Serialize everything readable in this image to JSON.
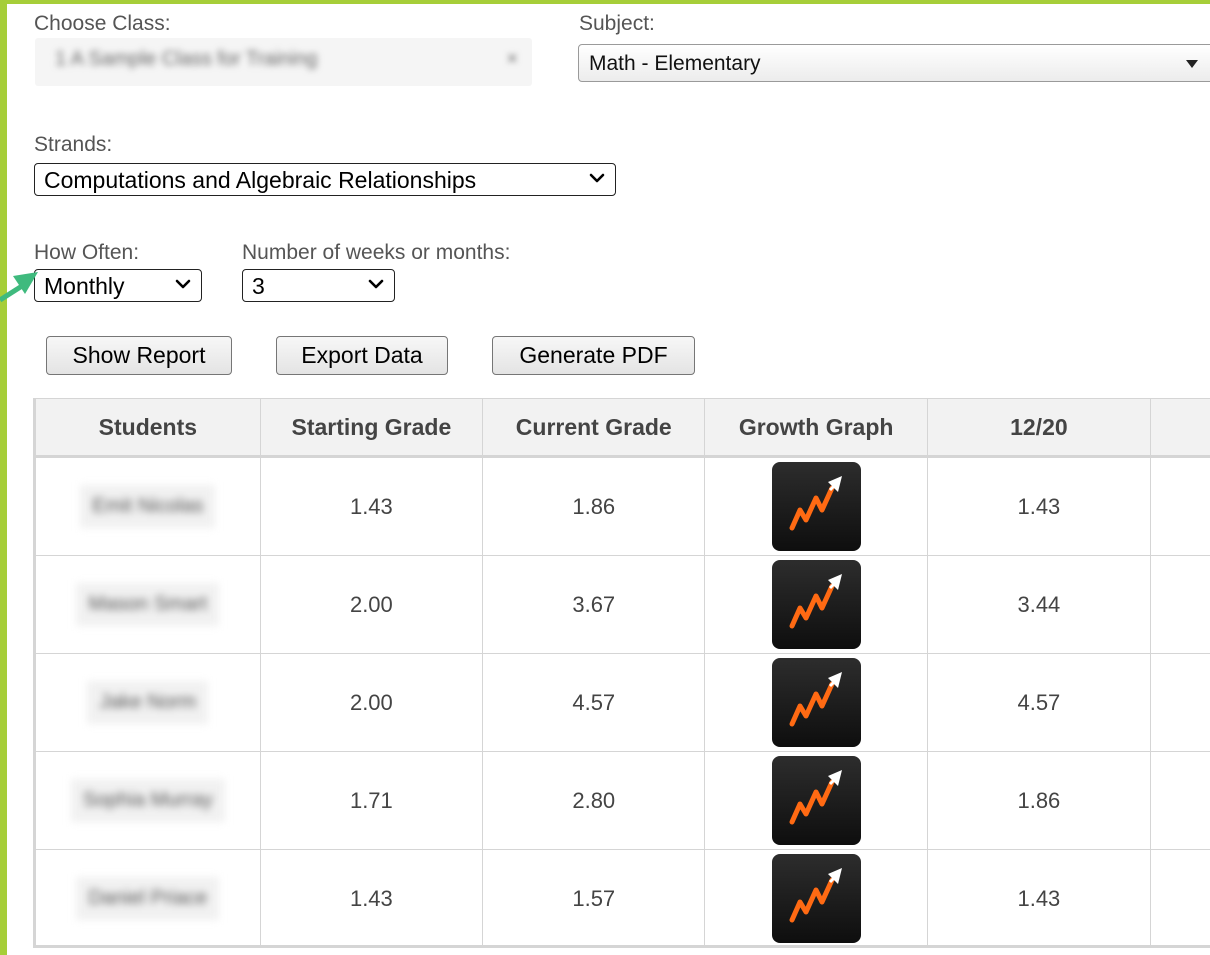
{
  "filters": {
    "class_label": "Choose Class:",
    "class_value": "1 A Sample Class for Training",
    "class_clear": "×",
    "subject_label": "Subject:",
    "subject_value": "Math - Elementary",
    "strands_label": "Strands:",
    "strands_value": "Computations and Algebraic Relationships",
    "how_often_label": "How Often:",
    "how_often_value": "Monthly",
    "weeks_label": "Number of weeks or months:",
    "weeks_value": "3"
  },
  "buttons": {
    "show_report": "Show Report",
    "export_data": "Export Data",
    "generate_pdf": "Generate PDF"
  },
  "table": {
    "headers": [
      "Students",
      "Starting Grade",
      "Current Grade",
      "Growth Graph",
      "12/20",
      ""
    ],
    "rows": [
      {
        "student": "Emit Nicolas",
        "starting": "1.43",
        "current": "1.86",
        "period": "1.43"
      },
      {
        "student": "Mason Smart",
        "starting": "2.00",
        "current": "3.67",
        "period": "3.44"
      },
      {
        "student": "Jake Norm",
        "starting": "2.00",
        "current": "4.57",
        "period": "4.57"
      },
      {
        "student": "Sophia Murray",
        "starting": "1.71",
        "current": "2.80",
        "period": "1.86"
      },
      {
        "student": "Daniel Priace",
        "starting": "1.43",
        "current": "1.57",
        "period": "1.43"
      }
    ]
  },
  "icons": {
    "growth": "growth-graph-icon",
    "annotation": "green-pointer-arrow-icon",
    "dropdown": "chevron-down-icon"
  },
  "colors": {
    "frame": "#a6ce39",
    "arrow": "#3fba7e",
    "graph_line": "#ff6a13"
  }
}
